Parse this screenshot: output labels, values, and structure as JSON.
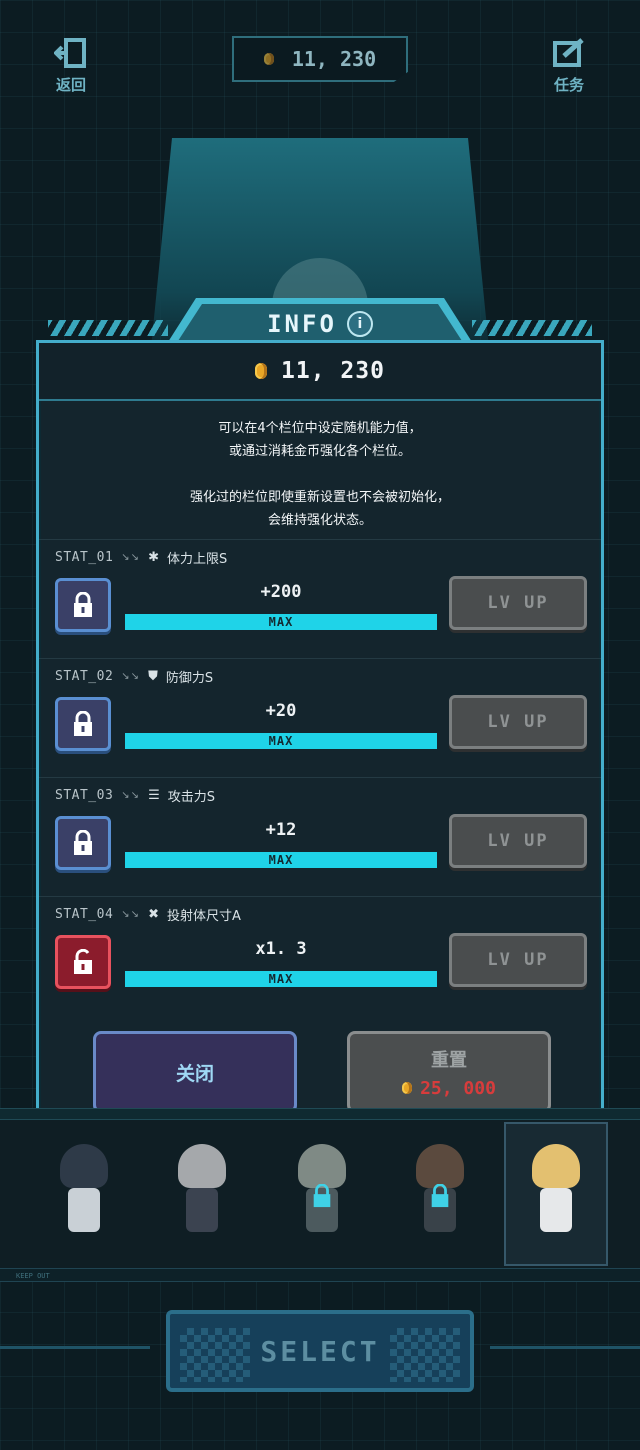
{
  "top_bar": {
    "back_label": "返回",
    "coins": "11, 230",
    "mission_label": "任务"
  },
  "info_panel": {
    "title": "INFO",
    "info_icon_glyph": "i",
    "coins": "11, 230",
    "description": [
      "可以在4个栏位中设定随机能力值，",
      "或通过消耗金币强化各个栏位。",
      "",
      "强化过的栏位即使重新设置也不会被初始化，",
      "会维持强化状态。"
    ],
    "stats": [
      {
        "code": "STAT_01",
        "arrows": "↘↘",
        "icon": "asterisk-icon",
        "glyph": "✱",
        "name": "体力上限S",
        "value": "+200",
        "bar_text": "MAX",
        "fill": 1.0,
        "locked": true,
        "button": "LV UP"
      },
      {
        "code": "STAT_02",
        "arrows": "↘↘",
        "icon": "shield-icon",
        "glyph": "⛊",
        "name": "防御力S",
        "value": "+20",
        "bar_text": "MAX",
        "fill": 1.0,
        "locked": true,
        "button": "LV UP"
      },
      {
        "code": "STAT_03",
        "arrows": "↘↘",
        "icon": "attack-icon",
        "glyph": "☰",
        "name": "攻击力S",
        "value": "+12",
        "bar_text": "MAX",
        "fill": 1.0,
        "locked": true,
        "button": "LV UP"
      },
      {
        "code": "STAT_04",
        "arrows": "↘↘",
        "icon": "cross-icon",
        "glyph": "✖",
        "name": "投射体尺寸A",
        "value": "x1. 3",
        "bar_text": "MAX",
        "fill": 1.0,
        "locked": false,
        "button": "LV UP"
      }
    ],
    "close_label": "关闭",
    "reset_label": "重置",
    "reset_cost": "25, 000"
  },
  "bottom": {
    "keepout_text": "KEEP OUT",
    "select_label": "SELECT"
  },
  "colors": {
    "accent": "#44aecb",
    "bar": "#1fd3e8",
    "cost_red": "#d73c3c",
    "coin": "#e8a626"
  }
}
